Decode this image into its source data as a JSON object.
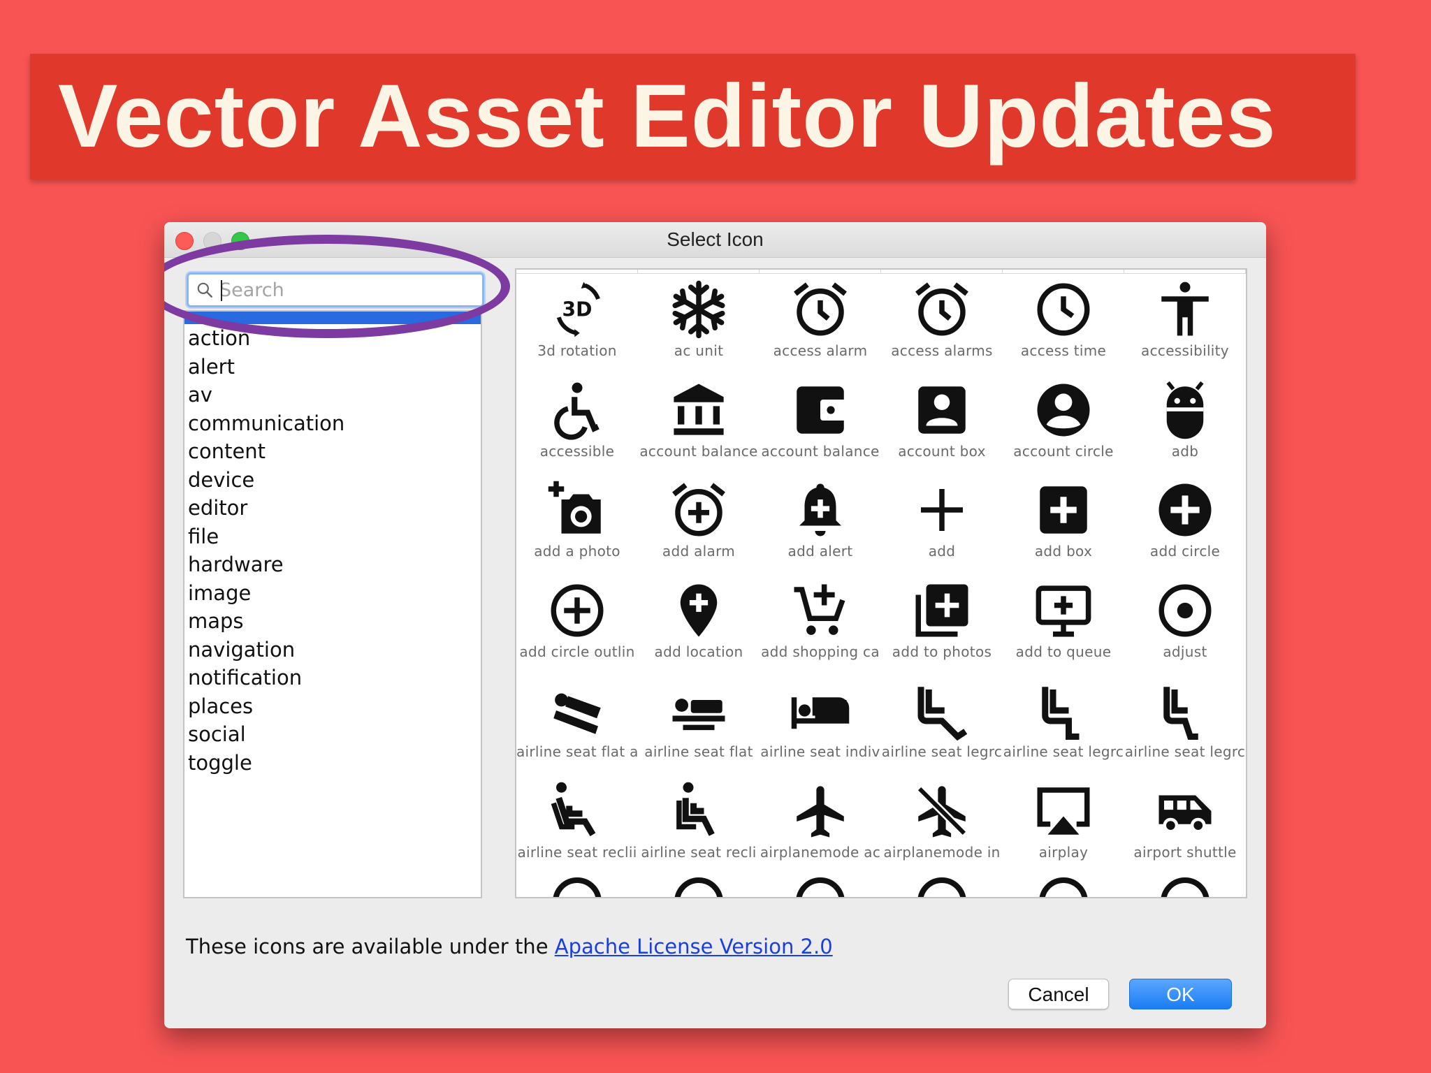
{
  "slide": {
    "title": "Vector Asset Editor Updates"
  },
  "dialog": {
    "title": "Select Icon",
    "search": {
      "placeholder": "Search",
      "value": ""
    },
    "categories": [
      "action",
      "alert",
      "av",
      "communication",
      "content",
      "device",
      "editor",
      "file",
      "hardware",
      "image",
      "maps",
      "navigation",
      "notification",
      "places",
      "social",
      "toggle"
    ],
    "icons": [
      {
        "label": "3d rotation",
        "icon": "3d-rotation-icon"
      },
      {
        "label": "ac unit",
        "icon": "ac-unit-icon"
      },
      {
        "label": "access alarm",
        "icon": "access-alarm-icon"
      },
      {
        "label": "access alarms",
        "icon": "access-alarms-icon"
      },
      {
        "label": "access time",
        "icon": "access-time-icon"
      },
      {
        "label": "accessibility",
        "icon": "accessibility-icon"
      },
      {
        "label": "accessible",
        "icon": "accessible-icon"
      },
      {
        "label": "account balance",
        "icon": "account-balance-icon"
      },
      {
        "label": "account balance",
        "icon": "account-balance-wallet-icon"
      },
      {
        "label": "account box",
        "icon": "account-box-icon"
      },
      {
        "label": "account circle",
        "icon": "account-circle-icon"
      },
      {
        "label": "adb",
        "icon": "adb-icon"
      },
      {
        "label": "add a photo",
        "icon": "add-a-photo-icon"
      },
      {
        "label": "add alarm",
        "icon": "add-alarm-icon"
      },
      {
        "label": "add alert",
        "icon": "add-alert-icon"
      },
      {
        "label": "add",
        "icon": "add-icon"
      },
      {
        "label": "add box",
        "icon": "add-box-icon"
      },
      {
        "label": "add circle",
        "icon": "add-circle-icon"
      },
      {
        "label": "add circle outlin",
        "icon": "add-circle-outline-icon"
      },
      {
        "label": "add location",
        "icon": "add-location-icon"
      },
      {
        "label": "add shopping ca",
        "icon": "add-shopping-cart-icon"
      },
      {
        "label": "add to photos",
        "icon": "add-to-photos-icon"
      },
      {
        "label": "add to queue",
        "icon": "add-to-queue-icon"
      },
      {
        "label": "adjust",
        "icon": "adjust-icon"
      },
      {
        "label": "airline seat flat a",
        "icon": "airline-seat-flat-angled-icon"
      },
      {
        "label": "airline seat flat",
        "icon": "airline-seat-flat-icon"
      },
      {
        "label": "airline seat indiv",
        "icon": "airline-seat-individual-suite-icon"
      },
      {
        "label": "airline seat legrc",
        "icon": "airline-seat-legroom-extra-icon"
      },
      {
        "label": "airline seat legrc",
        "icon": "airline-seat-legroom-normal-icon"
      },
      {
        "label": "airline seat legrc",
        "icon": "airline-seat-legroom-reduced-icon"
      },
      {
        "label": "airline seat reclii",
        "icon": "airline-seat-recline-extra-icon"
      },
      {
        "label": "airline seat recli",
        "icon": "airline-seat-recline-normal-icon"
      },
      {
        "label": "airplanemode ac",
        "icon": "airplanemode-active-icon"
      },
      {
        "label": "airplanemode in",
        "icon": "airplanemode-inactive-icon"
      },
      {
        "label": "airplay",
        "icon": "airplay-icon"
      },
      {
        "label": "airport shuttle",
        "icon": "airport-shuttle-icon"
      }
    ],
    "license": {
      "text": "These icons are available under the ",
      "link": "Apache License Version 2.0"
    },
    "buttons": {
      "cancel": "Cancel",
      "ok": "OK"
    },
    "colors": {
      "selection": "#2a6ae0",
      "ok_button": "#1b7cf4",
      "highlight_ring": "#7d3aa0",
      "link": "#1a3ee6"
    }
  }
}
